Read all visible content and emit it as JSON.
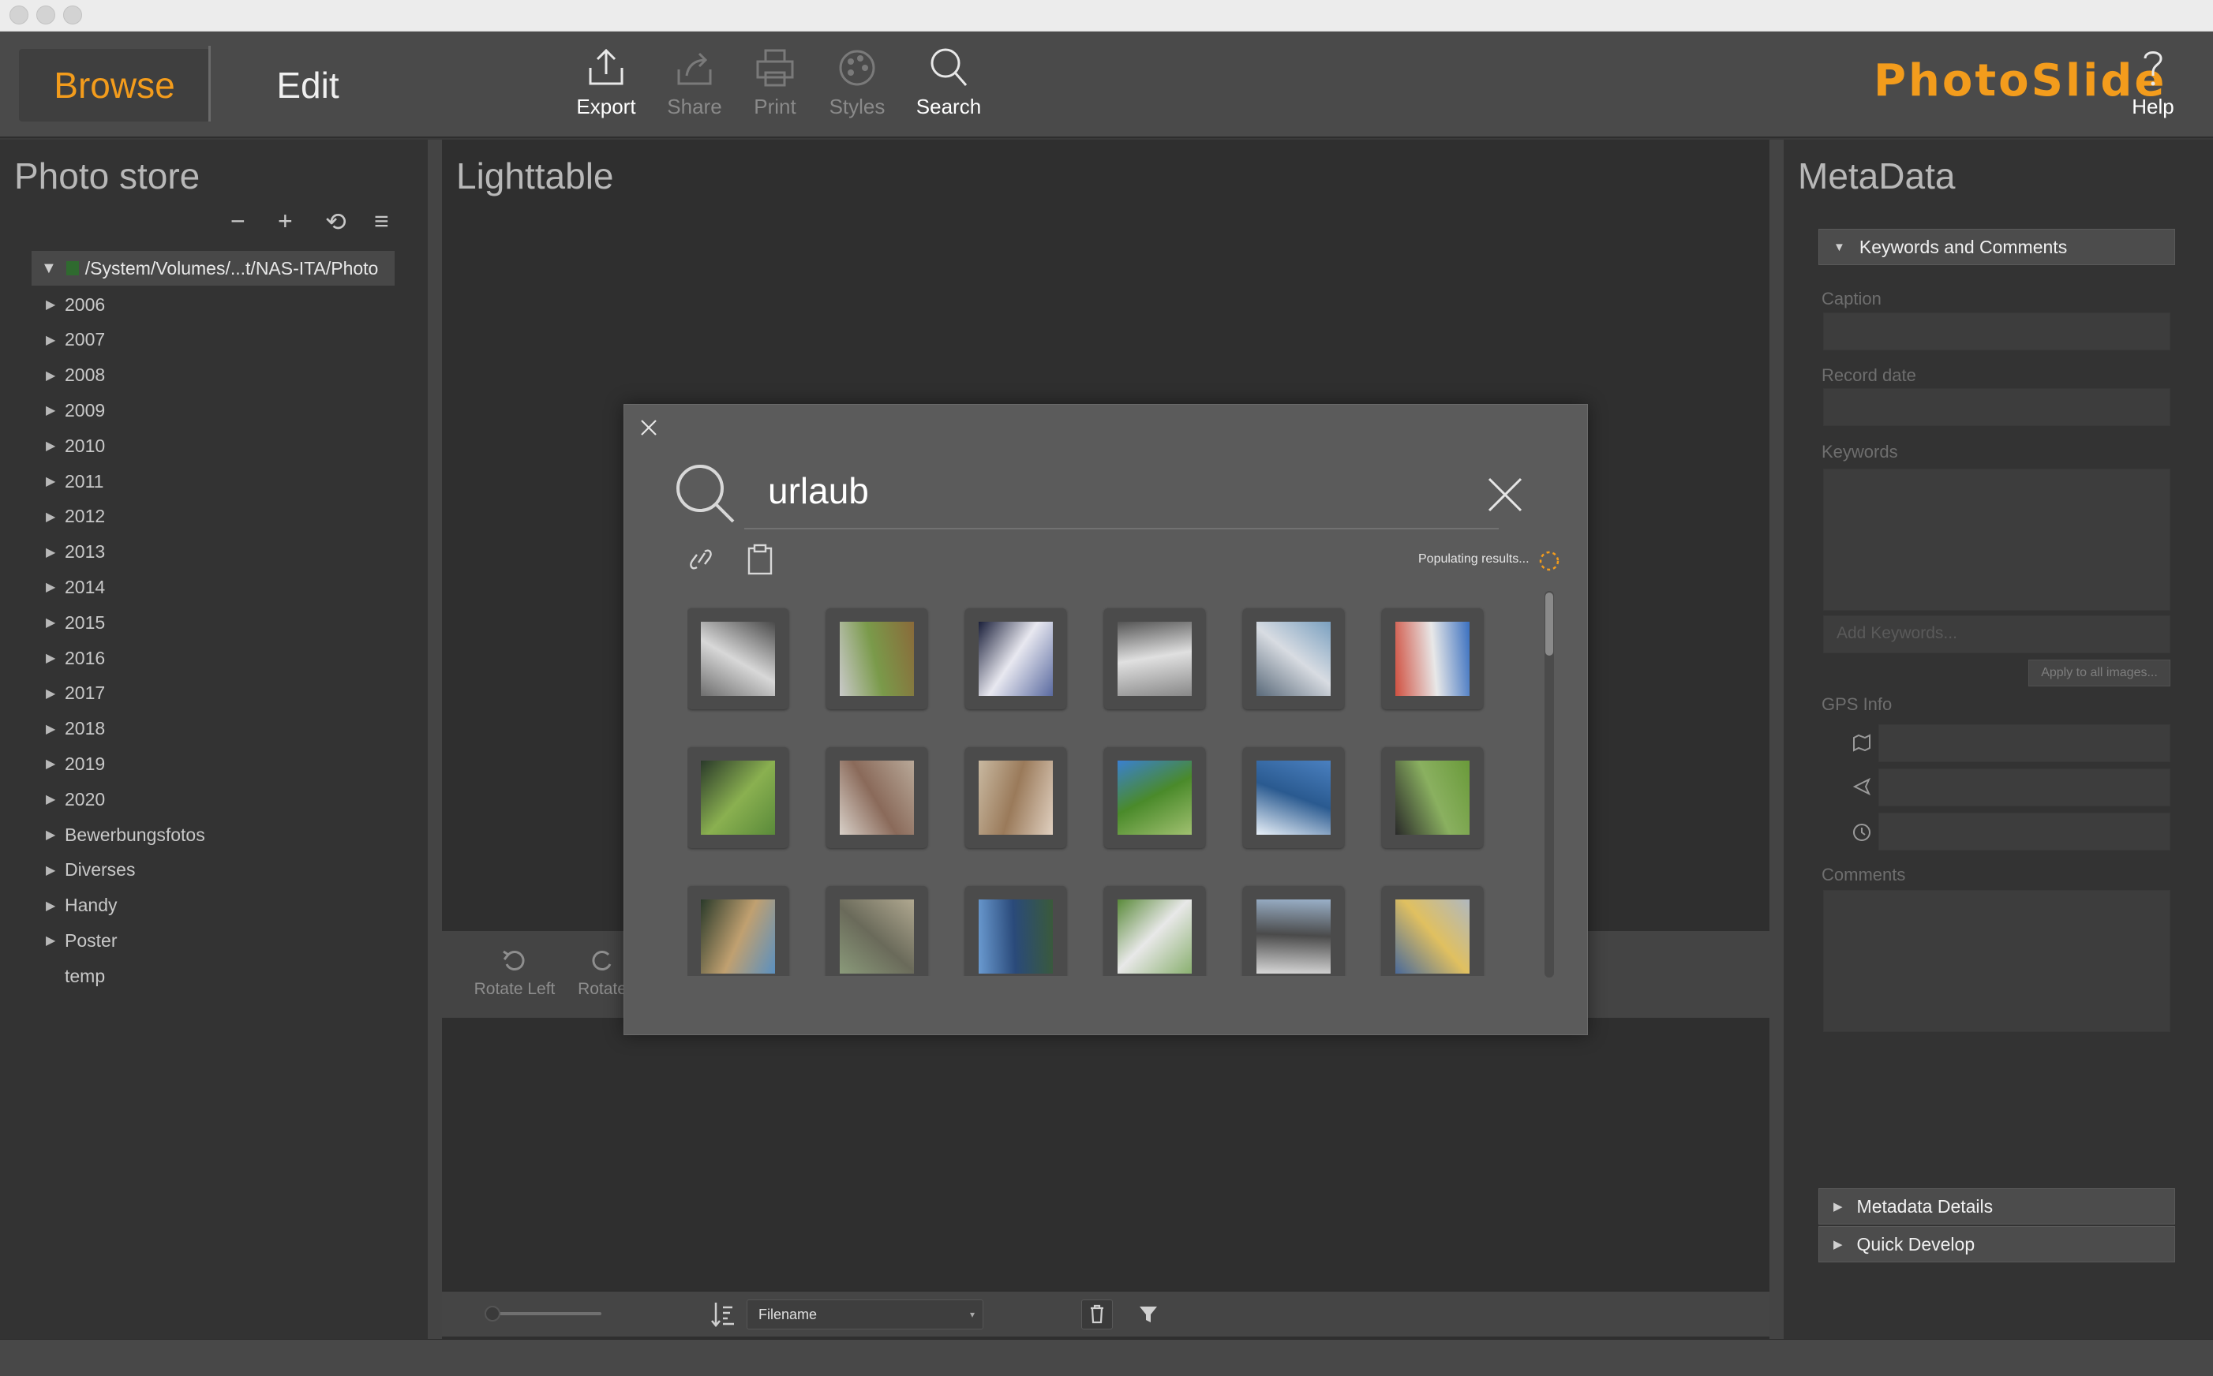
{
  "toolbar": {
    "browse_label": "Browse",
    "edit_label": "Edit",
    "buttons": [
      {
        "label": "Export",
        "icon": "export-icon",
        "enabled": true
      },
      {
        "label": "Share",
        "icon": "share-icon",
        "enabled": false
      },
      {
        "label": "Print",
        "icon": "print-icon",
        "enabled": false
      },
      {
        "label": "Styles",
        "icon": "palette-icon",
        "enabled": false
      },
      {
        "label": "Search",
        "icon": "search-icon",
        "enabled": true
      }
    ],
    "brand": "PhotoSlide",
    "help_label": "Help"
  },
  "photo_store": {
    "title": "Photo store",
    "tools": [
      "−",
      "+",
      "⟲",
      "≡"
    ],
    "root_path": "/System/Volumes/...t/NAS-ITA/Photo",
    "items": [
      {
        "label": "2006",
        "expandable": true
      },
      {
        "label": "2007",
        "expandable": true
      },
      {
        "label": "2008",
        "expandable": true
      },
      {
        "label": "2009",
        "expandable": true
      },
      {
        "label": "2010",
        "expandable": true
      },
      {
        "label": "2011",
        "expandable": true
      },
      {
        "label": "2012",
        "expandable": true
      },
      {
        "label": "2013",
        "expandable": true
      },
      {
        "label": "2014",
        "expandable": true
      },
      {
        "label": "2015",
        "expandable": true
      },
      {
        "label": "2016",
        "expandable": true
      },
      {
        "label": "2017",
        "expandable": true
      },
      {
        "label": "2018",
        "expandable": true
      },
      {
        "label": "2019",
        "expandable": true
      },
      {
        "label": "2020",
        "expandable": true
      },
      {
        "label": "Bewerbungsfotos",
        "expandable": true
      },
      {
        "label": "Diverses",
        "expandable": true
      },
      {
        "label": "Handy",
        "expandable": true
      },
      {
        "label": "Poster",
        "expandable": true
      },
      {
        "label": "temp",
        "expandable": false
      }
    ]
  },
  "lighttable": {
    "title": "Lighttable",
    "rotate_left_label": "Rotate Left",
    "rotate_right_label": "Rotate",
    "sort_field": "Filename"
  },
  "search_dialog": {
    "query": "urlaub",
    "status": "Populating results...",
    "thumbnails": [
      {
        "colors": [
          "#6e6e6e",
          "#d8d8d8",
          "#4a4a4a"
        ],
        "desc": "building"
      },
      {
        "colors": [
          "#c9c9c9",
          "#7a9a4a",
          "#8a6a3a"
        ],
        "desc": "bike"
      },
      {
        "colors": [
          "#1a1f3a",
          "#e8e8f0",
          "#5a6aa0"
        ],
        "desc": "dark"
      },
      {
        "colors": [
          "#555555",
          "#e0e0e0",
          "#888888"
        ],
        "desc": "building"
      },
      {
        "colors": [
          "#7aa0c0",
          "#d8dce2",
          "#5a6a7a"
        ],
        "desc": "interior"
      },
      {
        "colors": [
          "#3a70c0",
          "#e8e8e8",
          "#d05040"
        ],
        "desc": "boat"
      },
      {
        "colors": [
          "#5a8a3a",
          "#8ab050",
          "#2a3a2a"
        ],
        "desc": "grass"
      },
      {
        "colors": [
          "#d8d0c8",
          "#8a6a5a",
          "#b8a898"
        ],
        "desc": "beach"
      },
      {
        "colors": [
          "#c8b8a0",
          "#9a7a5a",
          "#e0d0c0"
        ],
        "desc": "room"
      },
      {
        "colors": [
          "#3a80d0",
          "#4a8a2a",
          "#a0c070"
        ],
        "desc": "park"
      },
      {
        "colors": [
          "#4a80c0",
          "#2a5a90",
          "#e8f0f8"
        ],
        "desc": "sea"
      },
      {
        "colors": [
          "#6a9a3a",
          "#8ab060",
          "#2a2a2a"
        ],
        "desc": "meadow"
      },
      {
        "colors": [
          "#5a90c0",
          "#c0a070",
          "#2a3a2a"
        ],
        "desc": "dino"
      },
      {
        "colors": [
          "#8a9a7a",
          "#6a6a5a",
          "#b0a890"
        ],
        "desc": "animal"
      },
      {
        "colors": [
          "#6a9ad0",
          "#2a4a7a",
          "#3a5a3a"
        ],
        "desc": "lake"
      },
      {
        "colors": [
          "#5a8a3a",
          "#e8e8e8",
          "#8ab070"
        ],
        "desc": "street"
      },
      {
        "colors": [
          "#9ab0c8",
          "#4a4a4a",
          "#d8d8d8"
        ],
        "desc": "station"
      },
      {
        "colors": [
          "#b0b8c0",
          "#e0c060",
          "#4a6a9a"
        ],
        "desc": "board"
      }
    ]
  },
  "metadata": {
    "title": "MetaData",
    "keywords_section": "Keywords and Comments",
    "caption_label": "Caption",
    "record_date_label": "Record date",
    "keywords_label": "Keywords",
    "add_keywords_placeholder": "Add Keywords...",
    "apply_label": "Apply to all images...",
    "gps_label": "GPS Info",
    "comments_label": "Comments",
    "details_section": "Metadata Details",
    "quick_develop_section": "Quick Develop"
  },
  "colors": {
    "accent": "#f39c1c",
    "panel": "#333333",
    "modal": "#5b5b5b"
  }
}
